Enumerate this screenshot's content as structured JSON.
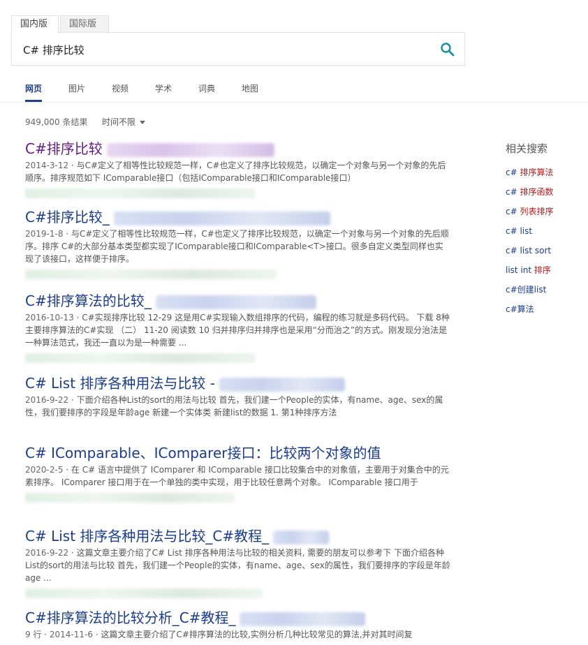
{
  "region_tabs": [
    "国内版",
    "国际版"
  ],
  "search": {
    "query": "C# 排序比较"
  },
  "nav": [
    "网页",
    "图片",
    "视频",
    "学术",
    "词典",
    "地图"
  ],
  "result_count": "949,000 条结果",
  "time_filter": "时间不限",
  "results": [
    {
      "title": "C#排序比较",
      "date": "2014-3-12",
      "snippet": "与C#定义了相等性比较规范一样，C#也定义了排序比较规范，以确定一个对象与另一个对象的先后顺序。排序规范如下 IComparable接口（包括IComparable接口和IComparable接口）"
    },
    {
      "title": "C#排序比较_",
      "date": "2019-1-8",
      "snippet": "与C#定义了相等性比较规范一样，C#也定义了排序比较规范，以确定一个对象与另一个对象的先后顺序。排序 C#的大部分基本类型都实现了IComparable接口和IComparable<T>接口。很多自定义类型同样也实现了该接口，这样便于排序。"
    },
    {
      "title": "C#排序算法的比较_",
      "date": "2016-10-13",
      "snippet": "C#实现排序比较 12-29 这是用C#实现输入数组排序的代码，编程的练习就是多码代码。 下载 8种主要排序算法的C#实现 （二） 11-20 阅读数 10 归并排序归并排序也是采用“分而治之”的方式。刚发现分治法是一种算法范式，我还一直以为是一种需要 ..."
    },
    {
      "title": "C# List 排序各种用法与比较 -",
      "date": "2016-9-22",
      "snippet": "下面介绍各种List的sort的用法与比较 首先，我们建一个People的实体，有name、age、sex的属性，我们要排序的字段是年龄age 新建一个实体类 新建list的数据 1. 第1种排序方法"
    },
    {
      "title": "C# IComparable、IComparer接口：比较两个对象的值",
      "date": "2020-2-5",
      "snippet": "在 C# 语言中提供了 IComparer 和 IComparable 接口比较集合中的对象值，主要用于对集合中的元素排序。 IComparer 接口用于在一个单独的类中实现，用于比较任意两个对象。 IComparable 接口用于"
    },
    {
      "title": "C# List 排序各种用法与比较_C#教程_",
      "date": "2016-9-22",
      "snippet": "这篇文章主要介绍了C# List 排序各种用法与比较的相关资料, 需要的朋友可以参考下 下面介绍各种List的sort的用法与比较 首先，我们建一个People的实体，有name、age、sex的属性，我们要排序的字段是年龄age ..."
    },
    {
      "title": "C#排序算法的比较分析_C#教程_",
      "date": "9 行 · 2014-11-6",
      "snippet": "这篇文章主要介绍了C#排序算法的比较,实例分析几种比较常见的算法,并对其时间复"
    }
  ],
  "related": {
    "title": "相关搜索",
    "items": [
      {
        "query": "c# ",
        "highlight": "排序算法"
      },
      {
        "query": "c# ",
        "highlight": "排序函数"
      },
      {
        "query": "c# ",
        "highlight": "列表排序"
      },
      {
        "query": "c# list",
        "highlight": ""
      },
      {
        "query": "c# list sort",
        "highlight": ""
      },
      {
        "query": "list int ",
        "highlight": "排序"
      },
      {
        "query": "c#创建list",
        "highlight": ""
      },
      {
        "query": "c#算法",
        "highlight": ""
      }
    ]
  },
  "colors": {
    "link": "#1a3c8d",
    "visited": "#6a1b8a",
    "highlight": "#c0171b",
    "search_icon": "#1a8fa0"
  }
}
